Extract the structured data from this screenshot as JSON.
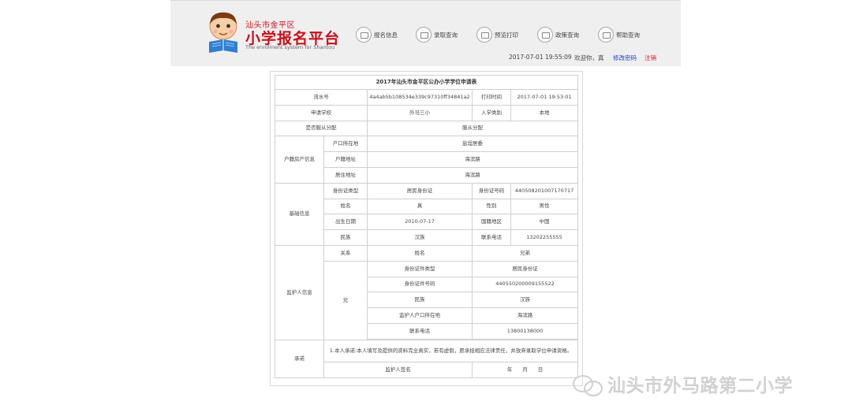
{
  "header": {
    "title_small": "汕头市金平区",
    "title_main": "小学报名平台",
    "title_en": "The enrolment system for Shantou",
    "nav": [
      {
        "label": "报名信息",
        "icon": "form-icon"
      },
      {
        "label": "录取查询",
        "icon": "form-icon"
      },
      {
        "label": "预览打印",
        "icon": "form-icon"
      },
      {
        "label": "政策查询",
        "icon": "form-icon"
      },
      {
        "label": "帮助查询",
        "icon": "form-icon"
      }
    ],
    "datetime": "2017-07-01 19:55:09",
    "welcome": "欢迎你，真",
    "change_password": "修改密码",
    "logout": "注销"
  },
  "form": {
    "title": "2017年汕头市金平区公办小学学位申请表",
    "serial_label": "流水号",
    "serial_value": "4a4ab5b108534e339c97310ff34841a2",
    "print_time_label": "打印时间",
    "print_time_value": "2017-07-01 19:53:01",
    "school_label": "申请学校",
    "school_value": "外马三小",
    "category_label": "入学类别",
    "category_value": "本地",
    "obey_label": "是否服从分配",
    "obey_value": "服从分配",
    "household_section": "户籍房产信息",
    "hukou_place_label": "户口所在地",
    "hukou_place_value": "盐埕居委",
    "hukou_addr_label": "户籍地址",
    "hukou_addr_value": "海滨路",
    "residence_label": "居住地址",
    "residence_value": "海滨路",
    "basic_section": "基础信息",
    "id_type_label": "身份证类型",
    "id_type_value": "居民身份证",
    "id_no_label": "身份证号码",
    "id_no_value": "440508201007170717",
    "name_label": "姓名",
    "name_value": "真",
    "gender_label": "性别",
    "gender_value": "男性",
    "birth_label": "出生日期",
    "birth_value": "2010-07-17",
    "nation_label": "国籍地区",
    "nation_value": "中国",
    "ethnic_label": "民族",
    "ethnic_value": "汉族",
    "phone_label": "联系电话",
    "phone_value": "13202255555",
    "guardian_section": "监护人信息",
    "relation_label": "关系",
    "g_name_label": "姓名",
    "g_name_value": "兄弟",
    "relation_value": "兄",
    "g_id_type_label": "身份证件类型",
    "g_id_type_value": "居民身份证",
    "g_id_no_label": "身份证件号码",
    "g_id_no_value": "440550200009155522",
    "g_ethnic_label": "民族",
    "g_ethnic_value": "汉族",
    "g_hukou_label": "监护人户口所在地",
    "g_hukou_value": "海滨路",
    "g_phone_label": "联系电话",
    "g_phone_value": "13800138000",
    "pledge_section": "承诺",
    "pledge_text": "1.本人承诺:本人填写及提供的资料完全真实，若有虚假，愿承担相应法律责任，并放弃录取学位申请资格。",
    "signature_label": "监护人签名",
    "date_text": "年　　月　　日"
  },
  "watermark": {
    "text": "汕头市外马路第二小学"
  }
}
